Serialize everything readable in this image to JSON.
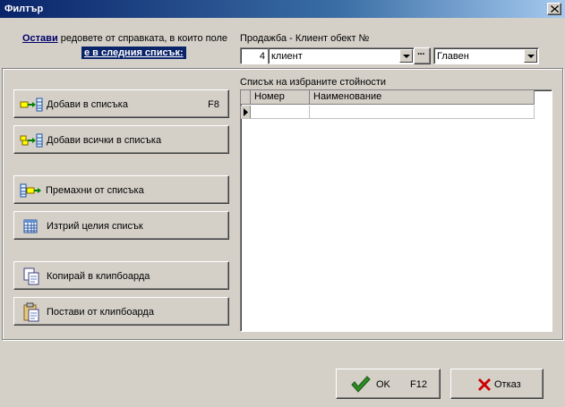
{
  "window": {
    "title": "Филтър"
  },
  "intro": {
    "link": "Остави",
    "text": "редовете от справката, в които поле",
    "highlight": "е в следния списък:"
  },
  "field": {
    "label": "Продажба - Клиент обект №"
  },
  "filter": {
    "number": "4",
    "entity": "клиент",
    "ellipsis": "···",
    "view": "Главен"
  },
  "list": {
    "label": "Списък на избраните стойности",
    "columns": [
      "Номер",
      "Наименование"
    ]
  },
  "buttons": {
    "add": {
      "label": "Добави в списъка",
      "key": "F8"
    },
    "add_all": {
      "label": "Добави всички в списъка"
    },
    "remove": {
      "label": "Премахни от списъка"
    },
    "clear": {
      "label": "Изтрий целия списък"
    },
    "copy": {
      "label": "Копирай в клипбоарда"
    },
    "paste": {
      "label": "Постави от клипбоарда"
    }
  },
  "footer": {
    "ok": {
      "label": "OK",
      "key": "F12"
    },
    "cancel": {
      "label": "Отказ"
    }
  },
  "icons": {
    "close": "close-icon",
    "add": "add-to-list-icon",
    "add_all": "add-all-icon",
    "remove": "remove-icon",
    "clear": "grid-clear-icon",
    "copy": "copy-icon",
    "paste": "paste-icon",
    "ok": "checkmark-icon",
    "cancel": "x-icon",
    "row_indicator": "row-pointer-icon"
  },
  "colors": {
    "title_bar": "#0a246a",
    "face": "#d4d0c8",
    "ok_check": "#2e8b22",
    "cancel_x": "#cc0000"
  }
}
